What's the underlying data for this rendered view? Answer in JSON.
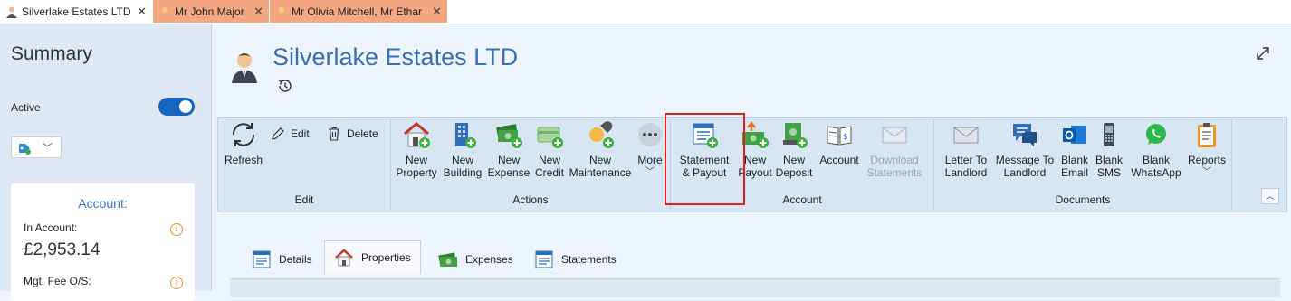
{
  "tabs": [
    {
      "label": "Silverlake Estates LTD",
      "close": "✕"
    },
    {
      "label": "Mr John Major",
      "close": "✕"
    },
    {
      "label": "Mr Olivia Mitchell, Mr Ethar",
      "close": "✕"
    }
  ],
  "sidebar": {
    "summary_title": "Summary",
    "active_label": "Active",
    "account_title": "Account:",
    "in_account_label": "In Account:",
    "in_account_value": "£2,953.14",
    "mgt_fee_label": "Mgt. Fee O/S:"
  },
  "header": {
    "title": "Silverlake Estates LTD"
  },
  "ribbon": {
    "edit_group": {
      "label": "Edit",
      "refresh": "Refresh",
      "edit": "Edit",
      "delete": "Delete"
    },
    "actions_group": {
      "label": "Actions",
      "new_property": [
        "New",
        "Property"
      ],
      "new_building": [
        "New",
        "Building"
      ],
      "new_expense": [
        "New",
        "Expense"
      ],
      "new_credit": [
        "New",
        "Credit"
      ],
      "new_maintenance": [
        "New",
        "Maintenance"
      ],
      "more": "More"
    },
    "account_group": {
      "label": "Account",
      "statement_payout": [
        "Statement",
        "& Payout"
      ],
      "new_payout": [
        "New",
        "Payout"
      ],
      "new_deposit": [
        "New",
        "Deposit"
      ],
      "account": "Account",
      "download_statements": [
        "Download",
        "Statements"
      ]
    },
    "documents_group": {
      "label": "Documents",
      "letter_to_landlord": [
        "Letter To",
        "Landlord"
      ],
      "message_to_landlord": [
        "Message To",
        "Landlord"
      ],
      "blank_email": [
        "Blank",
        "Email"
      ],
      "blank_sms": [
        "Blank",
        "SMS"
      ],
      "blank_whatsapp": [
        "Blank",
        "WhatsApp"
      ],
      "reports": "Reports"
    }
  },
  "content_tabs": [
    "Details",
    "Properties",
    "Expenses",
    "Statements"
  ],
  "colors": {
    "accent": "#1565c0",
    "title_blue": "#3a6fb0",
    "tab_orange": "#f4a882",
    "highlight_red": "#e02020"
  }
}
